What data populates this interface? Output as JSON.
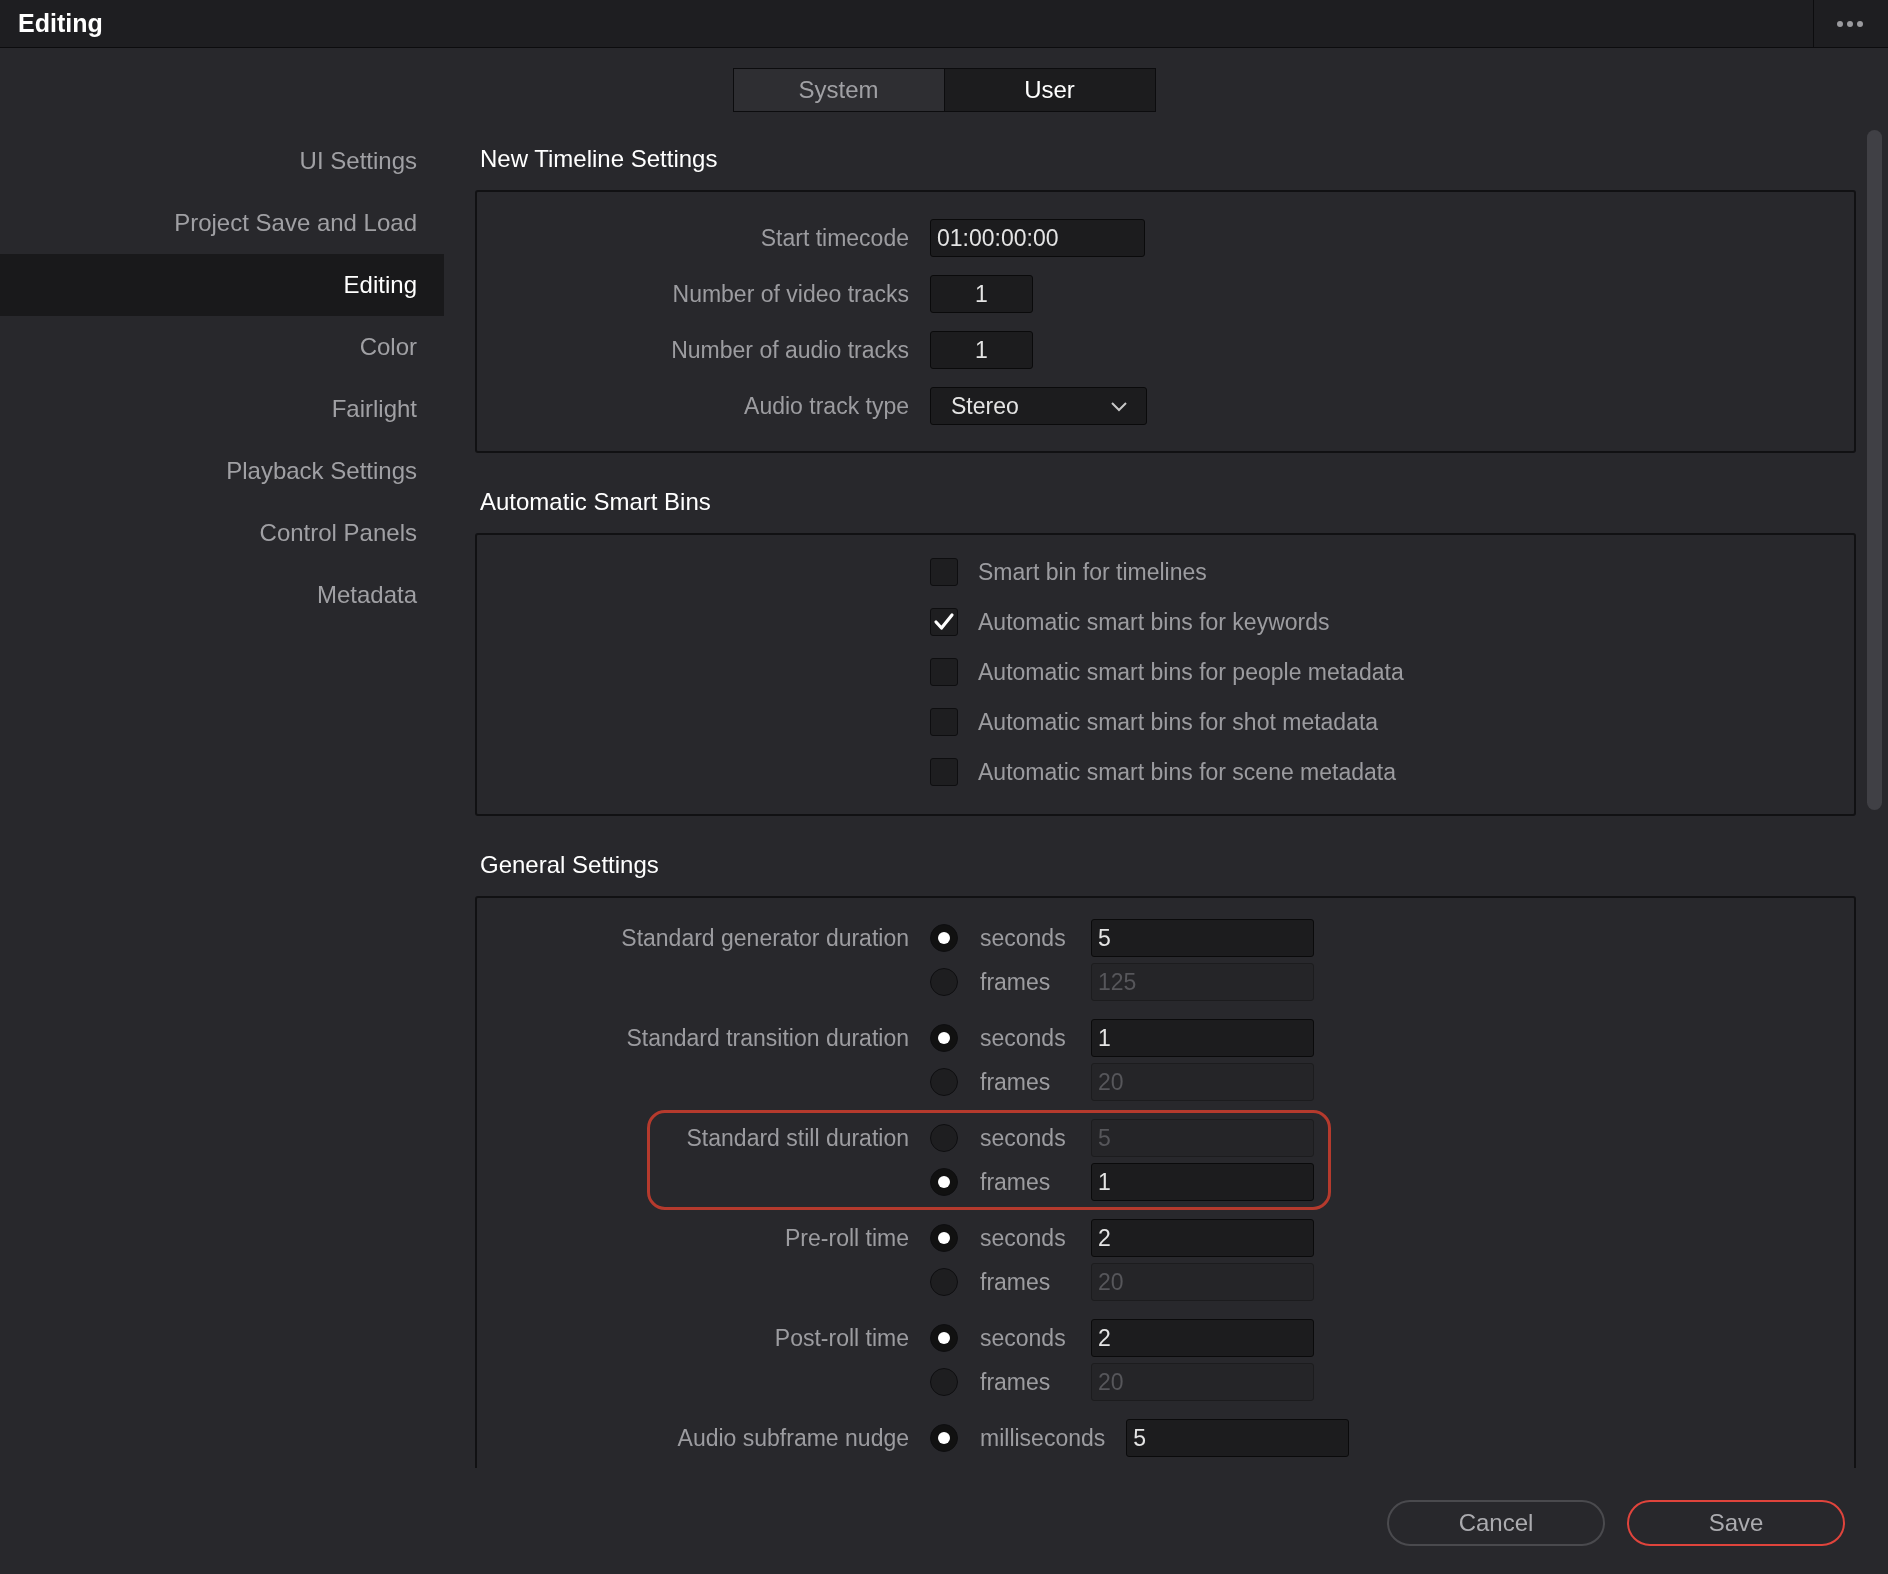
{
  "window": {
    "title": "Editing"
  },
  "tabs": [
    {
      "label": "System",
      "selected": false
    },
    {
      "label": "User",
      "selected": true
    }
  ],
  "sidebar": {
    "items": [
      {
        "label": "UI Settings",
        "selected": false
      },
      {
        "label": "Project Save and Load",
        "selected": false
      },
      {
        "label": "Editing",
        "selected": true
      },
      {
        "label": "Color",
        "selected": false
      },
      {
        "label": "Fairlight",
        "selected": false
      },
      {
        "label": "Playback Settings",
        "selected": false
      },
      {
        "label": "Control Panels",
        "selected": false
      },
      {
        "label": "Metadata",
        "selected": false
      }
    ]
  },
  "sections": [
    {
      "title": "New Timeline Settings",
      "kind": "fields",
      "rows": [
        {
          "label": "Start timecode",
          "kind": "text",
          "value": "01:00:00:00"
        },
        {
          "label": "Number of video tracks",
          "kind": "number",
          "value": "1"
        },
        {
          "label": "Number of audio tracks",
          "kind": "number",
          "value": "1"
        },
        {
          "label": "Audio track type",
          "kind": "dropdown",
          "value": "Stereo"
        }
      ]
    },
    {
      "title": "Automatic Smart Bins",
      "kind": "checkboxes",
      "items": [
        {
          "label": "Smart bin for timelines",
          "checked": false
        },
        {
          "label": "Automatic smart bins for keywords",
          "checked": true
        },
        {
          "label": "Automatic smart bins for people metadata",
          "checked": false
        },
        {
          "label": "Automatic smart bins for shot metadata",
          "checked": false
        },
        {
          "label": "Automatic smart bins for scene metadata",
          "checked": false
        }
      ]
    },
    {
      "title": "General Settings",
      "kind": "durations",
      "groups": [
        {
          "label": "Standard generator duration",
          "highlighted": false,
          "options": [
            {
              "unit": "seconds",
              "selected": true,
              "value": "5"
            },
            {
              "unit": "frames",
              "selected": false,
              "value": "125"
            }
          ]
        },
        {
          "label": "Standard transition duration",
          "highlighted": false,
          "options": [
            {
              "unit": "seconds",
              "selected": true,
              "value": "1"
            },
            {
              "unit": "frames",
              "selected": false,
              "value": "20"
            }
          ]
        },
        {
          "label": "Standard still duration",
          "highlighted": true,
          "options": [
            {
              "unit": "seconds",
              "selected": false,
              "value": "5"
            },
            {
              "unit": "frames",
              "selected": true,
              "value": "1"
            }
          ]
        },
        {
          "label": "Pre-roll time",
          "highlighted": false,
          "options": [
            {
              "unit": "seconds",
              "selected": true,
              "value": "2"
            },
            {
              "unit": "frames",
              "selected": false,
              "value": "20"
            }
          ]
        },
        {
          "label": "Post-roll time",
          "highlighted": false,
          "options": [
            {
              "unit": "seconds",
              "selected": true,
              "value": "2"
            },
            {
              "unit": "frames",
              "selected": false,
              "value": "20"
            }
          ]
        },
        {
          "label": "Audio subframe nudge",
          "highlighted": false,
          "options": [
            {
              "unit": "milliseconds",
              "selected": true,
              "value": "5"
            }
          ]
        }
      ]
    }
  ],
  "buttons": [
    {
      "label": "Cancel",
      "kind": "secondary"
    },
    {
      "label": "Save",
      "kind": "primary"
    }
  ]
}
